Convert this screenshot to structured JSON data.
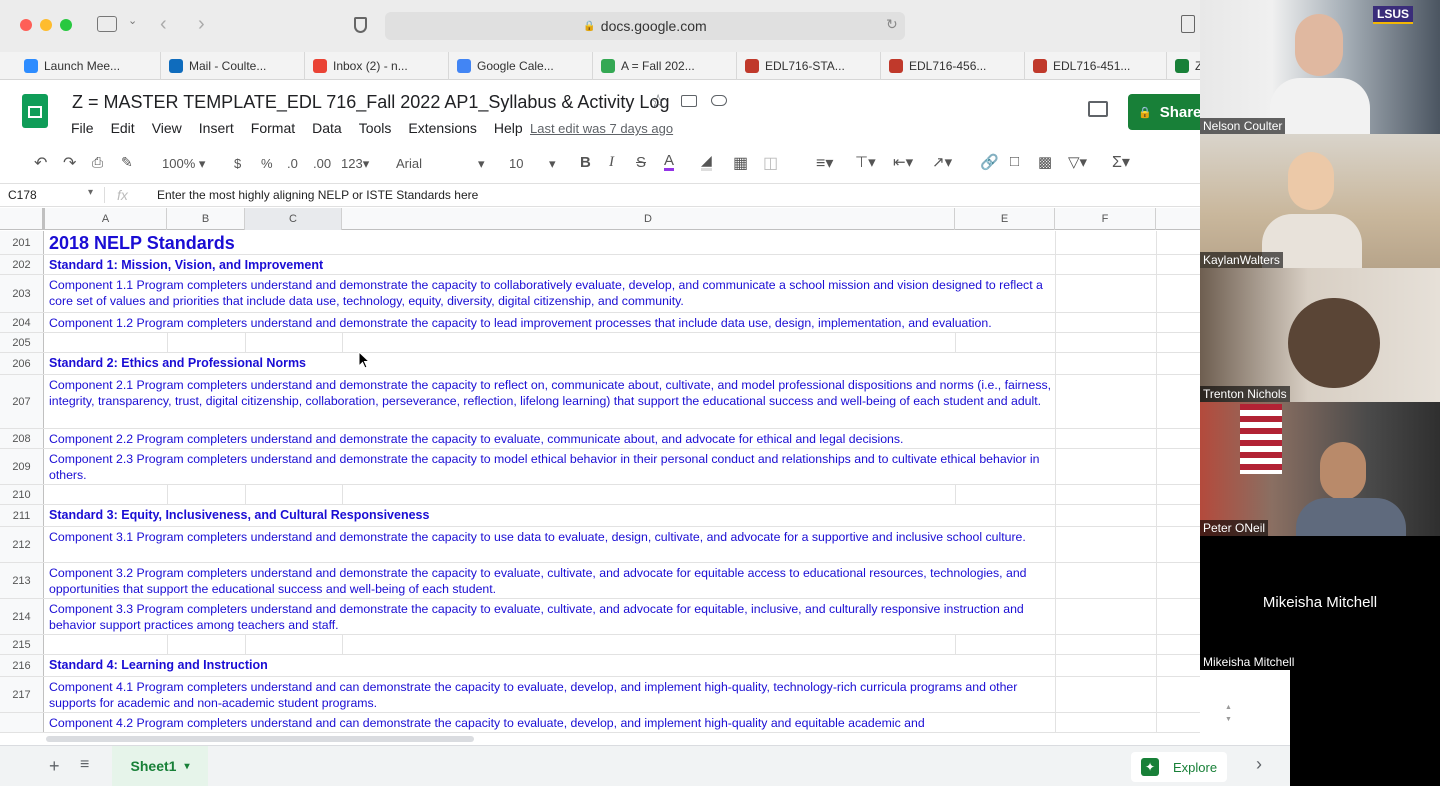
{
  "browser": {
    "url": "docs.google.com",
    "bookmarks": [
      {
        "label": "Launch Mee...",
        "color": "#2d8cff"
      },
      {
        "label": "Mail - Coulte...",
        "color": "#0f6cbd"
      },
      {
        "label": "Inbox (2) - n...",
        "color": "#ea4335"
      },
      {
        "label": "Google Cale...",
        "color": "#4285f4"
      },
      {
        "label": "A = Fall 202...",
        "color": "#34a853"
      },
      {
        "label": "EDL716-STA...",
        "color": "#c0392b"
      },
      {
        "label": "EDL716-456...",
        "color": "#c0392b"
      },
      {
        "label": "EDL716-451...",
        "color": "#c0392b"
      },
      {
        "label": "Z",
        "color": "#188038"
      }
    ]
  },
  "sheets": {
    "title": "Z = MASTER TEMPLATE_EDL 716_Fall 2022 AP1_Syllabus & Activity Log",
    "menu": [
      "File",
      "Edit",
      "View",
      "Insert",
      "Format",
      "Data",
      "Tools",
      "Extensions",
      "Help"
    ],
    "last_edit": "Last edit was 7 days ago",
    "share_label": "Share"
  },
  "toolbar": {
    "zoom": "100%",
    "currency": "$",
    "percent": "%",
    "dec_less": ".0",
    "dec_more": ".00",
    "format_more": "123",
    "font": "Arial",
    "font_size": "10"
  },
  "formula_bar": {
    "cell_ref": "C178",
    "fx": "fx",
    "content": "Enter the most highly aligning NELP or ISTE Standards here"
  },
  "columns": [
    "A",
    "B",
    "C",
    "D",
    "E",
    "F"
  ],
  "rows": [
    {
      "num": "201",
      "text": "2018 NELP Standards",
      "style": "heading"
    },
    {
      "num": "202",
      "text": "Standard 1: Mission, Vision, and Improvement",
      "style": "std"
    },
    {
      "num": "203",
      "text": "Component 1.1 Program completers understand and demonstrate the capacity to collaboratively evaluate, develop, and communicate a school mission and vision designed to reflect a core set of values and priorities that include data use, technology, equity, diversity, digital citizenship, and community.",
      "style": "comp"
    },
    {
      "num": "204",
      "text": "Component 1.2 Program completers understand and demonstrate the capacity to lead improvement processes that include data use, design, implementation, and evaluation.",
      "style": "comp"
    },
    {
      "num": "205",
      "text": "",
      "style": "empty"
    },
    {
      "num": "206",
      "text": "Standard 2: Ethics and Professional Norms",
      "style": "std"
    },
    {
      "num": "207",
      "text": "Component 2.1 Program completers understand and demonstrate the capacity to reflect on, communicate about, cultivate, and model professional dispositions and norms (i.e., fairness, integrity, transparency, trust, digital citizenship, collaboration, perseverance, reflection, lifelong learning) that support the educational success and well-being of each student and adult.",
      "style": "comp"
    },
    {
      "num": "208",
      "text": "Component 2.2 Program completers understand and demonstrate the capacity to evaluate, communicate about, and advocate for ethical and legal decisions.",
      "style": "comp"
    },
    {
      "num": "209",
      "text": "Component 2.3 Program completers understand and demonstrate the capacity to model ethical behavior in their personal conduct and relationships and to cultivate ethical behavior in others.",
      "style": "comp"
    },
    {
      "num": "210",
      "text": "",
      "style": "empty"
    },
    {
      "num": "211",
      "text": "Standard 3: Equity, Inclusiveness, and Cultural Responsiveness",
      "style": "std"
    },
    {
      "num": "212",
      "text": "Component 3.1 Program completers understand and demonstrate the capacity to use data to evaluate, design, cultivate, and advocate for a supportive and inclusive school culture.",
      "style": "comp"
    },
    {
      "num": "213",
      "text": "Component 3.2 Program completers understand and demonstrate the capacity to evaluate, cultivate, and advocate for equitable access to educational resources, technologies, and opportunities that support the educational success and well-being of each student.",
      "style": "comp"
    },
    {
      "num": "214",
      "text": "Component 3.3 Program completers understand and demonstrate the capacity to evaluate, cultivate, and advocate for equitable, inclusive, and culturally responsive instruction and behavior support practices among teachers and staff.",
      "style": "comp"
    },
    {
      "num": "215",
      "text": "",
      "style": "empty"
    },
    {
      "num": "216",
      "text": "Standard 4: Learning and Instruction",
      "style": "std"
    },
    {
      "num": "217",
      "text": "Component 4.1 Program completers understand and can demonstrate the capacity to evaluate, develop, and implement high-quality, technology-rich curricula programs and other supports for academic and non-academic student programs.",
      "style": "comp"
    },
    {
      "num": "",
      "text": "Component 4.2 Program completers understand and can demonstrate the capacity to evaluate, develop, and implement high-quality and equitable academic and",
      "style": "comp"
    }
  ],
  "bottom": {
    "sheet_tab": "Sheet1",
    "explore": "Explore"
  },
  "video": {
    "participants": [
      "Nelson Coulter",
      "KaylanWalters",
      "Trenton Nichols",
      "Peter ONeil",
      "Mikeisha Mitchell"
    ],
    "center_name": "Mikeisha Mitchell",
    "badge": "LSUS"
  }
}
